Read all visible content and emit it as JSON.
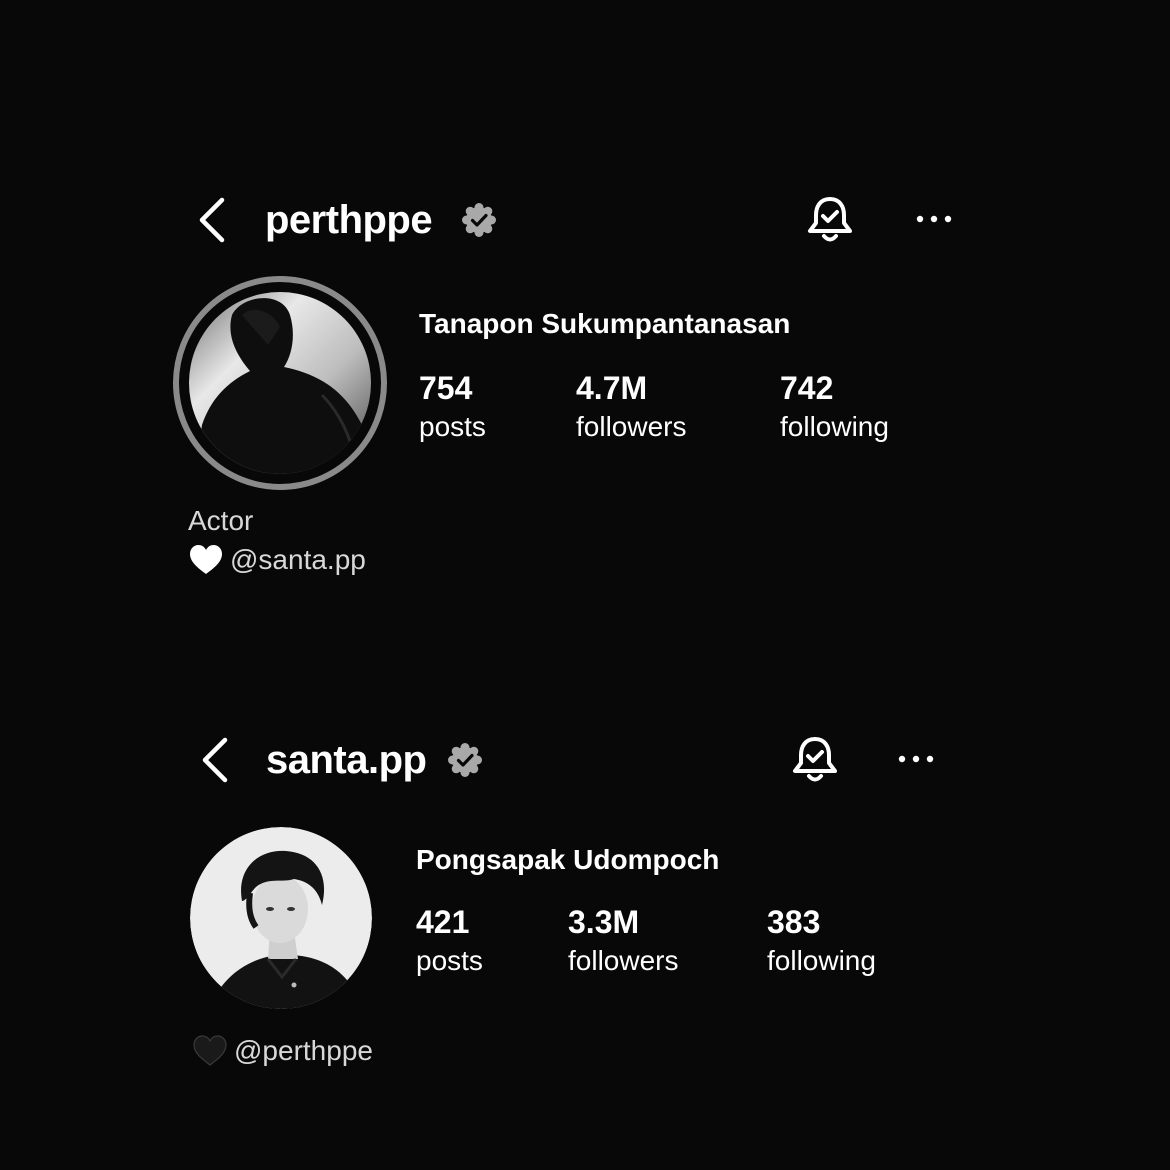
{
  "profiles": [
    {
      "username": "perthppe",
      "full_name": "Tanapon Sukumpantanasan",
      "stats": {
        "posts": {
          "value": "754",
          "label": "posts"
        },
        "followers": {
          "value": "4.7M",
          "label": "followers"
        },
        "following": {
          "value": "742",
          "label": "following"
        }
      },
      "bio": "Actor",
      "heart_icon": "white-heart-icon",
      "mention": "@santa.pp"
    },
    {
      "username": "santa.pp",
      "full_name": "Pongsapak Udompoch",
      "stats": {
        "posts": {
          "value": "421",
          "label": "posts"
        },
        "followers": {
          "value": "3.3M",
          "label": "followers"
        },
        "following": {
          "value": "383",
          "label": "following"
        }
      },
      "heart_icon": "black-heart-icon",
      "mention": "@perthppe"
    }
  ],
  "colors": {
    "background": "#080808",
    "text": "#ffffff",
    "secondary_text": "#d8d8d8",
    "verified_badge": "#a9a9a9",
    "story_ring": "#8a8a8a"
  }
}
